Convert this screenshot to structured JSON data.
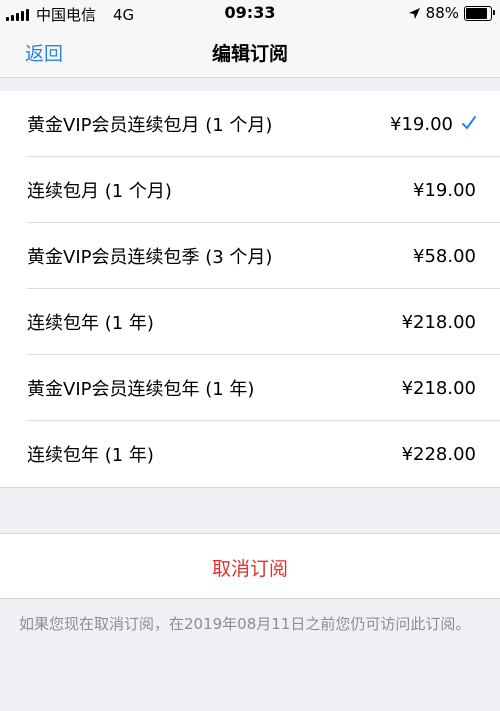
{
  "status_bar": {
    "carrier": "中国电信",
    "network": "4G",
    "time": "09:33",
    "battery_percent_text": "88%",
    "battery_level": 0.88
  },
  "nav": {
    "back_label": "返回",
    "title": "编辑订阅",
    "accent_color": "#2a86e0"
  },
  "subscriptions": [
    {
      "name": "黄金VIP会员连续包月 (1 个月)",
      "price": "¥19.00",
      "selected": true
    },
    {
      "name": "连续包月 (1 个月)",
      "price": "¥19.00",
      "selected": false
    },
    {
      "name": "黄金VIP会员连续包季 (3 个月)",
      "price": "¥58.00",
      "selected": false
    },
    {
      "name": "连续包年 (1 年)",
      "price": "¥218.00",
      "selected": false
    },
    {
      "name": "黄金VIP会员连续包年 (1 年)",
      "price": "¥218.00",
      "selected": false
    },
    {
      "name": "连续包年 (1 年)",
      "price": "¥228.00",
      "selected": false
    }
  ],
  "cancel": {
    "label": "取消订阅",
    "color": "#e0332a"
  },
  "footnote": "如果您现在取消订阅，在2019年08月11日之前您仍可访问此订阅。"
}
